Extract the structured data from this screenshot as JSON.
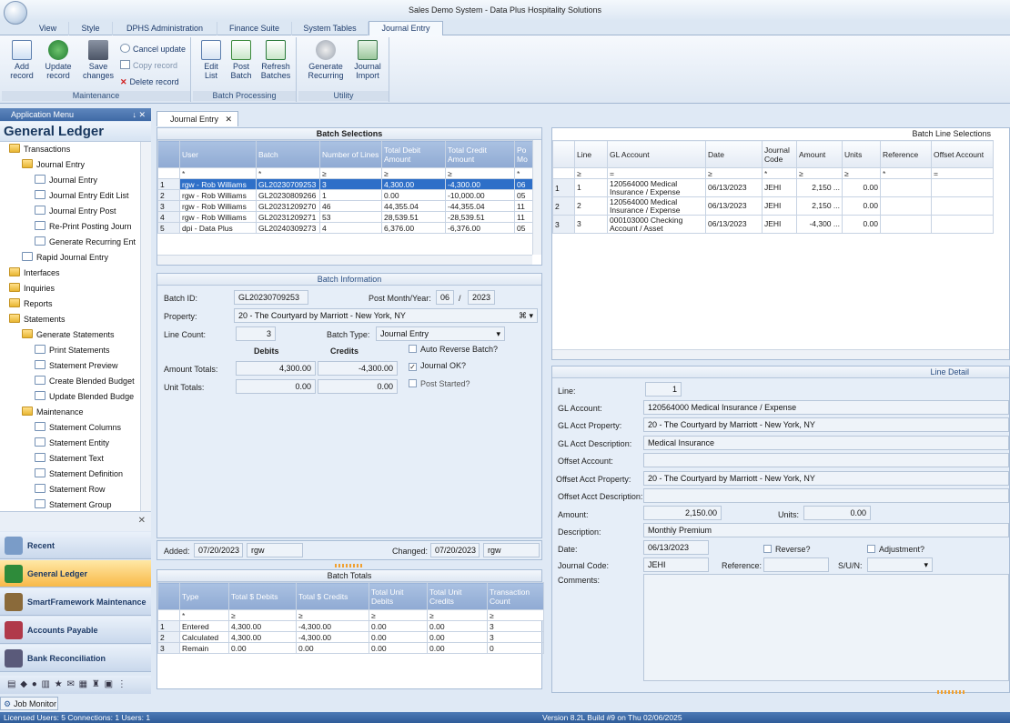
{
  "window": {
    "title": "Sales Demo System - Data Plus Hospitality Solutions"
  },
  "ribbon_tabs": [
    "View",
    "Style",
    "DPHS Administration",
    "Finance Suite",
    "System Tables",
    "Journal Entry"
  ],
  "ribbon": {
    "maintenance": {
      "label": "Maintenance",
      "add": "Add record",
      "update": "Update record",
      "save": "Save changes",
      "cancel": "Cancel update",
      "copy": "Copy record",
      "delete": "Delete record"
    },
    "batch_processing": {
      "label": "Batch Processing",
      "edit": "Edit List",
      "post": "Post Batch",
      "refresh": "Refresh Batches"
    },
    "utility": {
      "label": "Utility",
      "generate": "Generate Recurring",
      "import": "Journal Import"
    }
  },
  "app_menu": {
    "header": "Application Menu",
    "header_controls": "↓ ✕",
    "title": "General Ledger",
    "tree": [
      {
        "label": "Transactions",
        "indent": 0,
        "kind": "folder"
      },
      {
        "label": "Journal Entry",
        "indent": 1,
        "kind": "folder"
      },
      {
        "label": "Journal Entry",
        "indent": 2,
        "kind": "doc"
      },
      {
        "label": "Journal Entry Edit List",
        "indent": 2,
        "kind": "doc"
      },
      {
        "label": "Journal Entry Post",
        "indent": 2,
        "kind": "doc"
      },
      {
        "label": "Re-Print Posting Journ",
        "indent": 2,
        "kind": "doc"
      },
      {
        "label": "Generate Recurring Ent",
        "indent": 2,
        "kind": "doc"
      },
      {
        "label": "Rapid Journal Entry",
        "indent": 1,
        "kind": "doc"
      },
      {
        "label": "Interfaces",
        "indent": 0,
        "kind": "folder"
      },
      {
        "label": "Inquiries",
        "indent": 0,
        "kind": "folder"
      },
      {
        "label": "Reports",
        "indent": 0,
        "kind": "folder"
      },
      {
        "label": "Statements",
        "indent": 0,
        "kind": "folder"
      },
      {
        "label": "Generate Statements",
        "indent": 1,
        "kind": "folder"
      },
      {
        "label": "Print Statements",
        "indent": 2,
        "kind": "doc"
      },
      {
        "label": "Statement Preview",
        "indent": 2,
        "kind": "doc"
      },
      {
        "label": "Create Blended Budget",
        "indent": 2,
        "kind": "doc"
      },
      {
        "label": "Update Blended Budge",
        "indent": 2,
        "kind": "doc"
      },
      {
        "label": "Maintenance",
        "indent": 1,
        "kind": "folder"
      },
      {
        "label": "Statement Columns",
        "indent": 2,
        "kind": "doc"
      },
      {
        "label": "Statement Entity",
        "indent": 2,
        "kind": "doc"
      },
      {
        "label": "Statement Text",
        "indent": 2,
        "kind": "doc"
      },
      {
        "label": "Statement Definition",
        "indent": 2,
        "kind": "doc"
      },
      {
        "label": "Statement Row",
        "indent": 2,
        "kind": "doc"
      },
      {
        "label": "Statement Group",
        "indent": 2,
        "kind": "doc"
      }
    ],
    "nav": [
      "Recent",
      "General Ledger",
      "SmartFramework Maintenance",
      "Accounts Payable",
      "Bank Reconciliation"
    ],
    "nav_colors": [
      "#7a9cc8",
      "#2e8b3a",
      "#8a6a3a",
      "#b0394a",
      "#5a5a7a"
    ]
  },
  "doc_tab": "Journal Entry",
  "batch_selections": {
    "caption": "Batch Selections",
    "columns": [
      "User",
      "Batch",
      "Number of Lines",
      "Total Debit Amount",
      "Total Credit Amount",
      "Po Mo"
    ],
    "filter": [
      "*",
      "*",
      "≥",
      "≥",
      "≥",
      "*"
    ],
    "rows": [
      [
        "rgw - Rob Williams",
        "GL20230709253",
        "3",
        "4,300.00",
        "-4,300.00",
        "06"
      ],
      [
        "rgw - Rob Williams",
        "GL20230809266",
        "1",
        "0.00",
        "-10,000.00",
        "05"
      ],
      [
        "rgw - Rob Williams",
        "GL20231209270",
        "46",
        "44,355.04",
        "-44,355.04",
        "11"
      ],
      [
        "rgw - Rob Williams",
        "GL20231209271",
        "53",
        "28,539.51",
        "-28,539.51",
        "11"
      ],
      [
        "dpi - Data Plus",
        "GL20240309273",
        "4",
        "6,376.00",
        "-6,376.00",
        "05"
      ]
    ],
    "row_numbers": [
      "1",
      "2",
      "3",
      "4",
      "5"
    ]
  },
  "batch_info": {
    "caption": "Batch Information",
    "batch_id_label": "Batch ID:",
    "batch_id": "GL20230709253",
    "post_label": "Post Month/Year:",
    "post_month": "06",
    "post_sep": "/",
    "post_year": "2023",
    "property_label": "Property:",
    "property": "20  -  The Courtyard by Marriott  -  New York, NY",
    "line_count_label": "Line Count:",
    "line_count": "3",
    "batch_type_label": "Batch Type:",
    "batch_type": "Journal Entry",
    "debits_label": "Debits",
    "credits_label": "Credits",
    "amount_totals_label": "Amount Totals:",
    "amount_debit": "4,300.00",
    "amount_credit": "-4,300.00",
    "unit_totals_label": "Unit Totals:",
    "unit_debit": "0.00",
    "unit_credit": "0.00",
    "auto_reverse": "Auto Reverse Batch?",
    "journal_ok": "Journal OK?",
    "post_started": "Post Started?",
    "added_label": "Added:",
    "added_date": "07/20/2023",
    "added_user": "rgw",
    "changed_label": "Changed:",
    "changed_date": "07/20/2023",
    "changed_user": "rgw"
  },
  "batch_totals": {
    "caption": "Batch Totals",
    "columns": [
      "Type",
      "Total $ Debits",
      "Total $ Credits",
      "Total Unit Debits",
      "Total Unit Credits",
      "Transaction Count"
    ],
    "filter": [
      "*",
      "≥",
      "≥",
      "≥",
      "≥",
      "≥"
    ],
    "rows": [
      [
        "Entered",
        "4,300.00",
        "-4,300.00",
        "0.00",
        "0.00",
        "3"
      ],
      [
        "Calculated",
        "4,300.00",
        "-4,300.00",
        "0.00",
        "0.00",
        "3"
      ],
      [
        "Remain",
        "0.00",
        "0.00",
        "0.00",
        "0.00",
        "0"
      ]
    ],
    "row_numbers": [
      "1",
      "2",
      "3"
    ]
  },
  "batch_lines": {
    "caption": "Batch Line Selections",
    "columns": [
      "Line",
      "GL Account",
      "Date",
      "Journal Code",
      "Amount",
      "Units",
      "Reference",
      "Offset Account"
    ],
    "filter": [
      "≥",
      "=",
      "≥",
      "*",
      "≥",
      "≥",
      "*",
      "="
    ],
    "rows": [
      [
        "1",
        "120564000  Medical Insurance  /  Expense",
        "06/13/2023",
        "JEHI",
        "2,150 ...",
        "0.00",
        "",
        ""
      ],
      [
        "2",
        "120564000  Medical Insurance  /  Expense",
        "06/13/2023",
        "JEHI",
        "2,150 ...",
        "0.00",
        "",
        ""
      ],
      [
        "3",
        "000103000  Checking Account  /  Asset",
        "06/13/2023",
        "JEHI",
        "-4,300 ...",
        "0.00",
        "",
        ""
      ]
    ],
    "row_numbers": [
      "1",
      "2",
      "3"
    ]
  },
  "line_detail": {
    "caption": "Line Detail",
    "line_label": "Line:",
    "line": "1",
    "gl_account_label": "GL Account:",
    "gl_account": "120564000  Medical Insurance  /  Expense",
    "gl_prop_label": "GL Acct Property:",
    "gl_prop": "20  -  The Courtyard by Marriott  -  New York, NY",
    "gl_desc_label": "GL Acct Description:",
    "gl_desc": "Medical Insurance",
    "offset_label": "Offset Account:",
    "offset": "",
    "offset_prop_label": "Offset Acct Property:",
    "offset_prop": "20  -  The Courtyard by Marriott  -  New York, NY",
    "offset_desc_label": "Offset Acct Description:",
    "offset_desc": "",
    "amount_label": "Amount:",
    "amount": "2,150.00",
    "units_label": "Units:",
    "units": "0.00",
    "description_label": "Description:",
    "description": "Monthly Premium",
    "date_label": "Date:",
    "date": "06/13/2023",
    "reverse": "Reverse?",
    "adjustment": "Adjustment?",
    "journal_code_label": "Journal Code:",
    "journal_code": "JEHI",
    "reference_label": "Reference:",
    "reference": "",
    "suin_label": "S/U/N:",
    "comments_label": "Comments:"
  },
  "job_monitor": "Job Monitor",
  "status": {
    "left": "Licensed Users: 5 Connections: 1 Users: 1",
    "right": "Version 8.2L Build #9 on Thu 02/06/2025"
  },
  "colors": {
    "accent": "#2e6fc8",
    "header": "#8faad3",
    "nav_active": "#f8b948"
  }
}
